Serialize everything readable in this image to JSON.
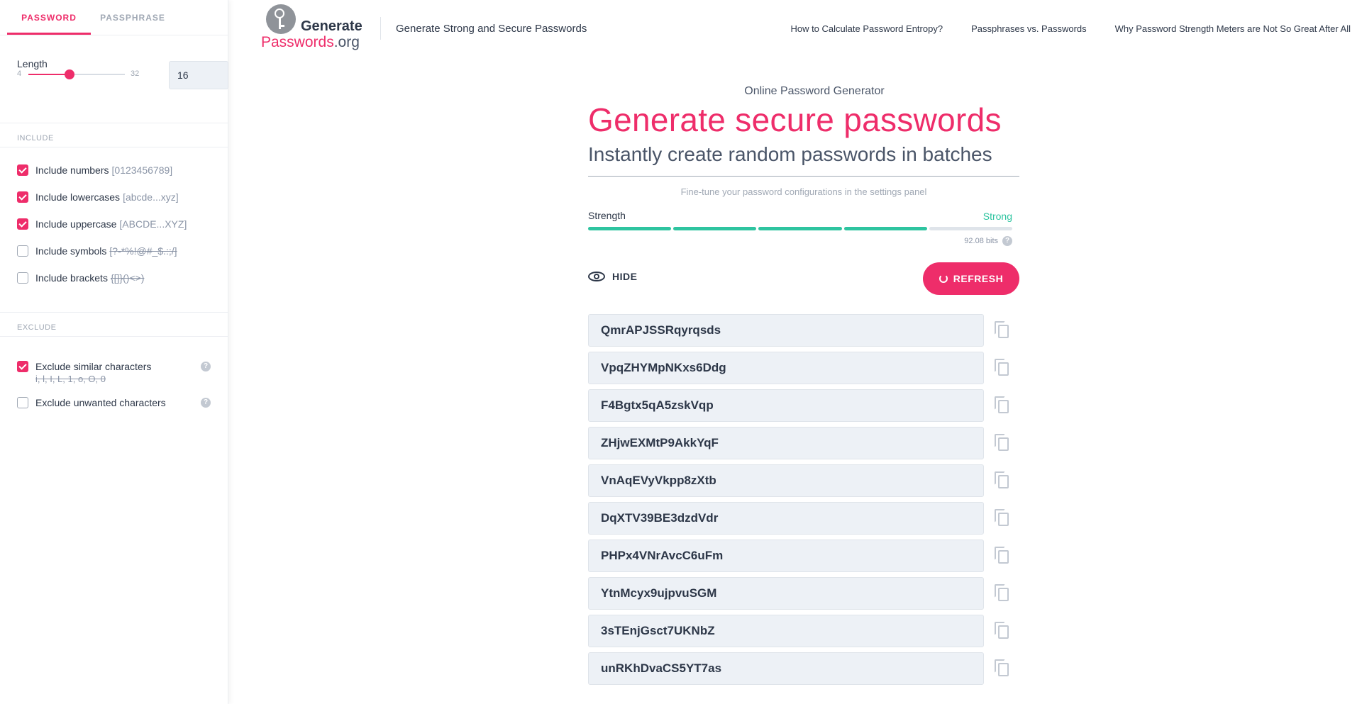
{
  "sidebar": {
    "tabs": [
      {
        "label": "PASSWORD",
        "active": true
      },
      {
        "label": "PASSPHRASE",
        "active": false
      }
    ],
    "length": {
      "label": "Length",
      "min": "4",
      "max": "32",
      "value": "16"
    },
    "include": {
      "header": "INCLUDE",
      "options": [
        {
          "label": "Include numbers",
          "hint": "[0123456789]",
          "checked": true,
          "strike": false
        },
        {
          "label": "Include lowercases",
          "hint": "[abcde...xyz]",
          "checked": true,
          "strike": false
        },
        {
          "label": "Include uppercase",
          "hint": "[ABCDE...XYZ]",
          "checked": true,
          "strike": false
        },
        {
          "label": "Include symbols",
          "hint": "[?-*%!@#_$.:;/]",
          "checked": false,
          "strike": true
        },
        {
          "label": "Include brackets",
          "hint": "{[]}()<>)",
          "checked": false,
          "strike": true
        }
      ]
    },
    "exclude": {
      "header": "EXCLUDE",
      "options": [
        {
          "label": "Exclude similar characters",
          "hint": "i, l, I, L, 1, o, O, 0",
          "checked": true
        },
        {
          "label": "Exclude unwanted characters",
          "hint": "",
          "checked": false
        }
      ]
    }
  },
  "header": {
    "logo_word1": "Generate",
    "logo_word2": "Passwords",
    "logo_word2_suffix": ".org",
    "tagline": "Generate Strong and Secure Passwords",
    "nav": [
      "How to Calculate Password Entropy?",
      "Passphrases vs. Passwords",
      "Why Password Strength Meters are Not So Great After All"
    ]
  },
  "main": {
    "eyebrow": "Online Password Generator",
    "headline": "Generate secure passwords",
    "subheadline": "Instantly create random passwords in batches",
    "fine_tune": "Fine-tune your password configurations in the settings panel",
    "strength": {
      "label": "Strength",
      "value": "Strong",
      "bits": "92.08 bits",
      "filled_segments": 4,
      "total_segments": 5
    },
    "hide_label": "HIDE",
    "refresh_label": "REFRESH",
    "passwords": [
      "QmrAPJSSRqyrqsds",
      "VpqZHYMpNKxs6Ddg",
      "F4Bgtx5qA5zskVqp",
      "ZHjwEXMtP9AkkYqF",
      "VnAqEVyVkpp8zXtb",
      "DqXTV39BE3dzdVdr",
      "PHPx4VNrAvcC6uFm",
      "YtnMcyx9ujpvuSGM",
      "3sTEnjGsct7UKNbZ",
      "unRKhDvaCS5YT7as"
    ]
  },
  "colors": {
    "accent": "#ee2d6a",
    "strength": "#2ec4a0"
  }
}
